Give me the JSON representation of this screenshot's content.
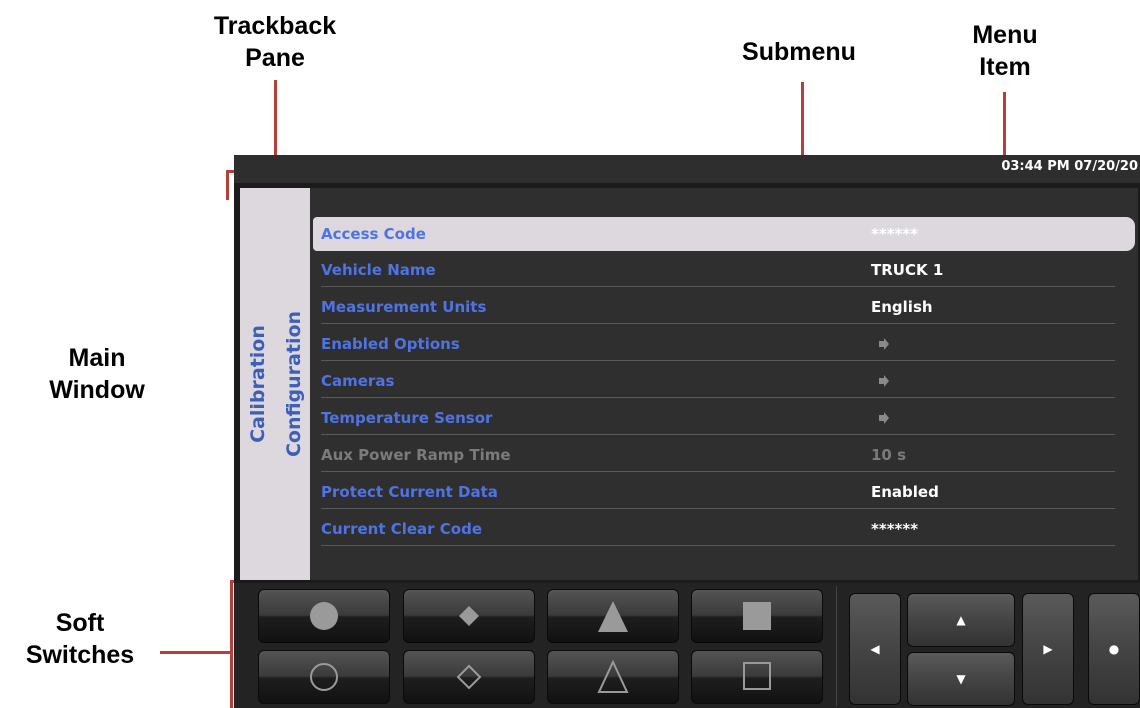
{
  "annotations": {
    "trackback_pane": "Trackback\nPane",
    "submenu": "Submenu",
    "menu_item": "Menu\nItem",
    "main_window": "Main\nWindow",
    "soft_switches": "Soft\nSwitches"
  },
  "status_bar": {
    "clock": "03:44 PM 07/20/20"
  },
  "trackback": {
    "tabs": [
      {
        "label": "Calibration"
      },
      {
        "label": "Configuration"
      }
    ]
  },
  "menu": {
    "items": [
      {
        "label": "Access Code",
        "value": "******",
        "selected": true
      },
      {
        "label": "Vehicle Name",
        "value": "TRUCK 1"
      },
      {
        "label": "Measurement Units",
        "value": "English"
      },
      {
        "label": "Enabled Options",
        "value": "",
        "submenu": true
      },
      {
        "label": "Cameras",
        "value": "",
        "submenu": true
      },
      {
        "label": "Temperature Sensor",
        "value": "",
        "submenu": true
      },
      {
        "label": "Aux Power Ramp Time",
        "value": "10 s",
        "disabled": true
      },
      {
        "label": "Protect Current Data",
        "value": "Enabled"
      },
      {
        "label": "Current Clear Code",
        "value": "******"
      }
    ]
  },
  "soft_switches": [
    {
      "icon": "filled-circle-icon"
    },
    {
      "icon": "filled-diamond-icon"
    },
    {
      "icon": "filled-triangle-icon"
    },
    {
      "icon": "filled-square-icon"
    },
    {
      "icon": "outline-circle-icon"
    },
    {
      "icon": "outline-diamond-icon"
    },
    {
      "icon": "outline-triangle-icon"
    },
    {
      "icon": "outline-square-icon"
    }
  ],
  "nav_buttons": {
    "left": "◀",
    "up": "▲",
    "down": "▼",
    "right": "▶",
    "enter": "●"
  },
  "colors": {
    "menu_label": "#4f73e3",
    "callout_line": "#b5403b",
    "selection": "#dcd8de"
  }
}
